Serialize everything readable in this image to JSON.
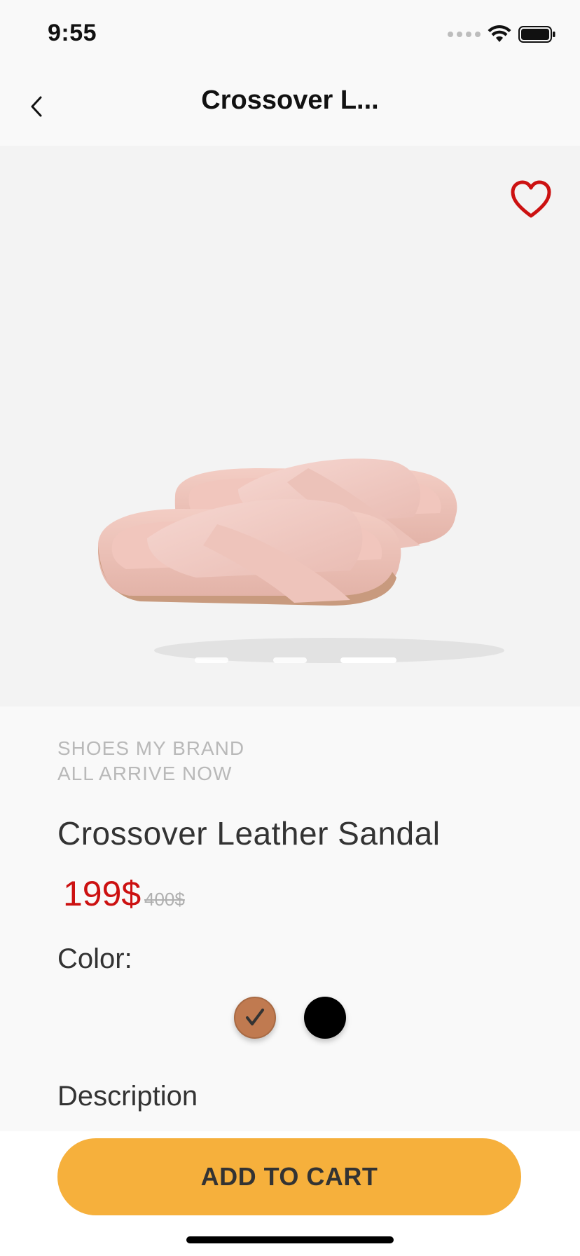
{
  "status_bar": {
    "time": "9:55"
  },
  "nav": {
    "title": "Crossover L..."
  },
  "hero": {
    "image_alt": "Pink crossover leather slide sandals",
    "carousel": {
      "count": 3,
      "active_index": 2
    }
  },
  "product": {
    "brand_line1": "SHOES MY BRAND",
    "brand_line2": "ALL ARRIVE NOW",
    "name": "Crossover Leather Sandal",
    "price": "199$",
    "old_price": "400$",
    "color_label": "Color:",
    "colors": [
      {
        "name": "tan",
        "hex": "#c07a50",
        "selected": true
      },
      {
        "name": "black",
        "hex": "#000000",
        "selected": false
      }
    ],
    "description_label": "Description"
  },
  "actions": {
    "add_to_cart": "ADD TO CART"
  },
  "theme": {
    "accent": "#f6b03c",
    "price_red": "#cc1111",
    "heart_red": "#cc1111"
  }
}
